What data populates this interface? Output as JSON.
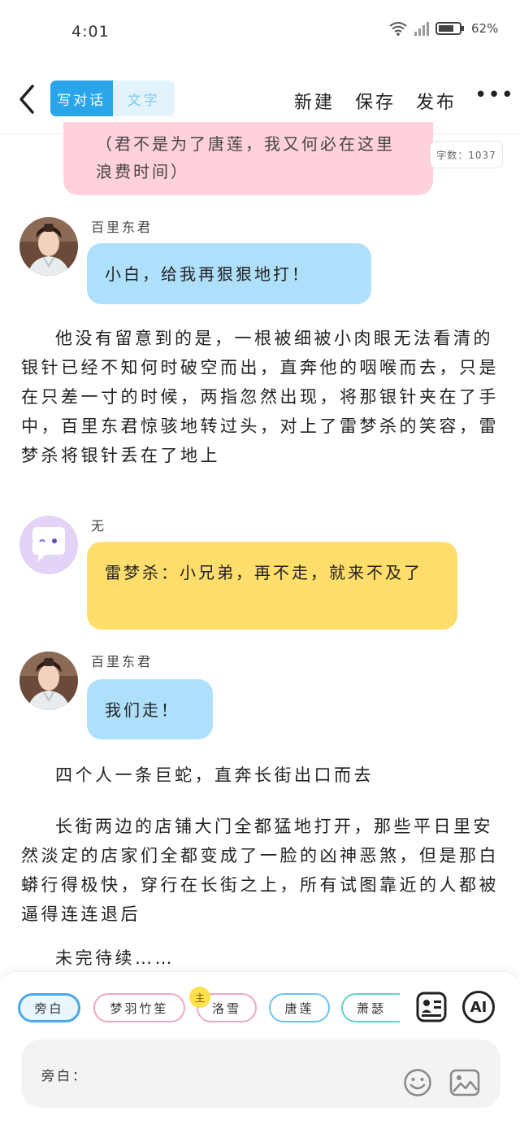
{
  "status_bar": {
    "time": "4:01",
    "battery": "62%"
  },
  "nav": {
    "mode_dialog": "写对话",
    "mode_text": "文字",
    "new": "新建",
    "save": "保存",
    "publish": "发布",
    "more": "•••"
  },
  "word_count": "字数：1037",
  "pink_bubble": "（君不是为了唐莲，我又何必在这里浪费时间）",
  "messages": [
    {
      "speaker": "百里东君",
      "text": "小白，给我再狠狠地打！"
    },
    {
      "speaker": "无",
      "text": "雷梦杀：小兄弟，再不走，就来不及了"
    },
    {
      "speaker": "百里东君",
      "text": "我们走！"
    }
  ],
  "paragraphs": [
    "他没有留意到的是，一根被细被小肉眼无法看清的银针已经不知何时破空而出，直奔他的咽喉而去，只是在只差一寸的时候，两指忽然出现，将那银针夹在了手中，百里东君惊骇地转过头，对上了雷梦杀的笑容，雷梦杀将银针丢在了地上",
    "四个人一条巨蛇，直奔长街出口而去",
    "长街两边的店铺大门全都猛地打开，那些平日里安然淡定的店家们全都变成了一脸的凶神恶煞，但是那白蟒行得极快，穿行在长街之上，所有试图靠近的人都被逼得连连退后",
    "未完待续……"
  ],
  "roles": [
    "旁白",
    "梦羽竹笙",
    "洛雪",
    "唐莲",
    "萧瑟"
  ],
  "main_badge": "主",
  "ai_label": "AI",
  "input_label": "旁白：",
  "colors": {
    "accent": "#29a6ea",
    "pink_bubble": "#ffd1dc",
    "blue_bubble": "#aee0fb",
    "yellow_bubble": "#ffde6b"
  }
}
